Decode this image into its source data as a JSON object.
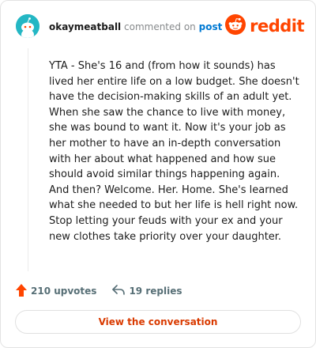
{
  "header": {
    "author": "okaymeatball",
    "action": "commented on",
    "post_link": "post",
    "brand": "reddit"
  },
  "comment": {
    "text": "YTA - She's 16 and (from how it sounds) has lived her entire life on a low budget. She doesn't have the decision-making skills of an adult yet. When she saw the chance to live with money, she was bound to want it. Now it's your job as her mother to have an in-depth conversation with her about what happened and how sue should avoid similar things happening again. And then? Welcome. Her. Home. She's learned what she needed to but her life is hell right now. Stop letting your feuds with your ex and your new clothes take priority over your daughter."
  },
  "stats": {
    "upvotes": "210 upvotes",
    "replies": "19 replies"
  },
  "cta": {
    "label": "View the conversation"
  },
  "colors": {
    "brand": "#ff4500",
    "link": "#0079d3",
    "cta_text": "#d93a00",
    "avatar_bg": "#24b7c4"
  },
  "icons": {
    "avatar": "snoo-avatar-icon",
    "brand": "reddit-logo-icon",
    "upvote": "upvote-arrow-icon",
    "reply": "reply-arrow-icon"
  }
}
